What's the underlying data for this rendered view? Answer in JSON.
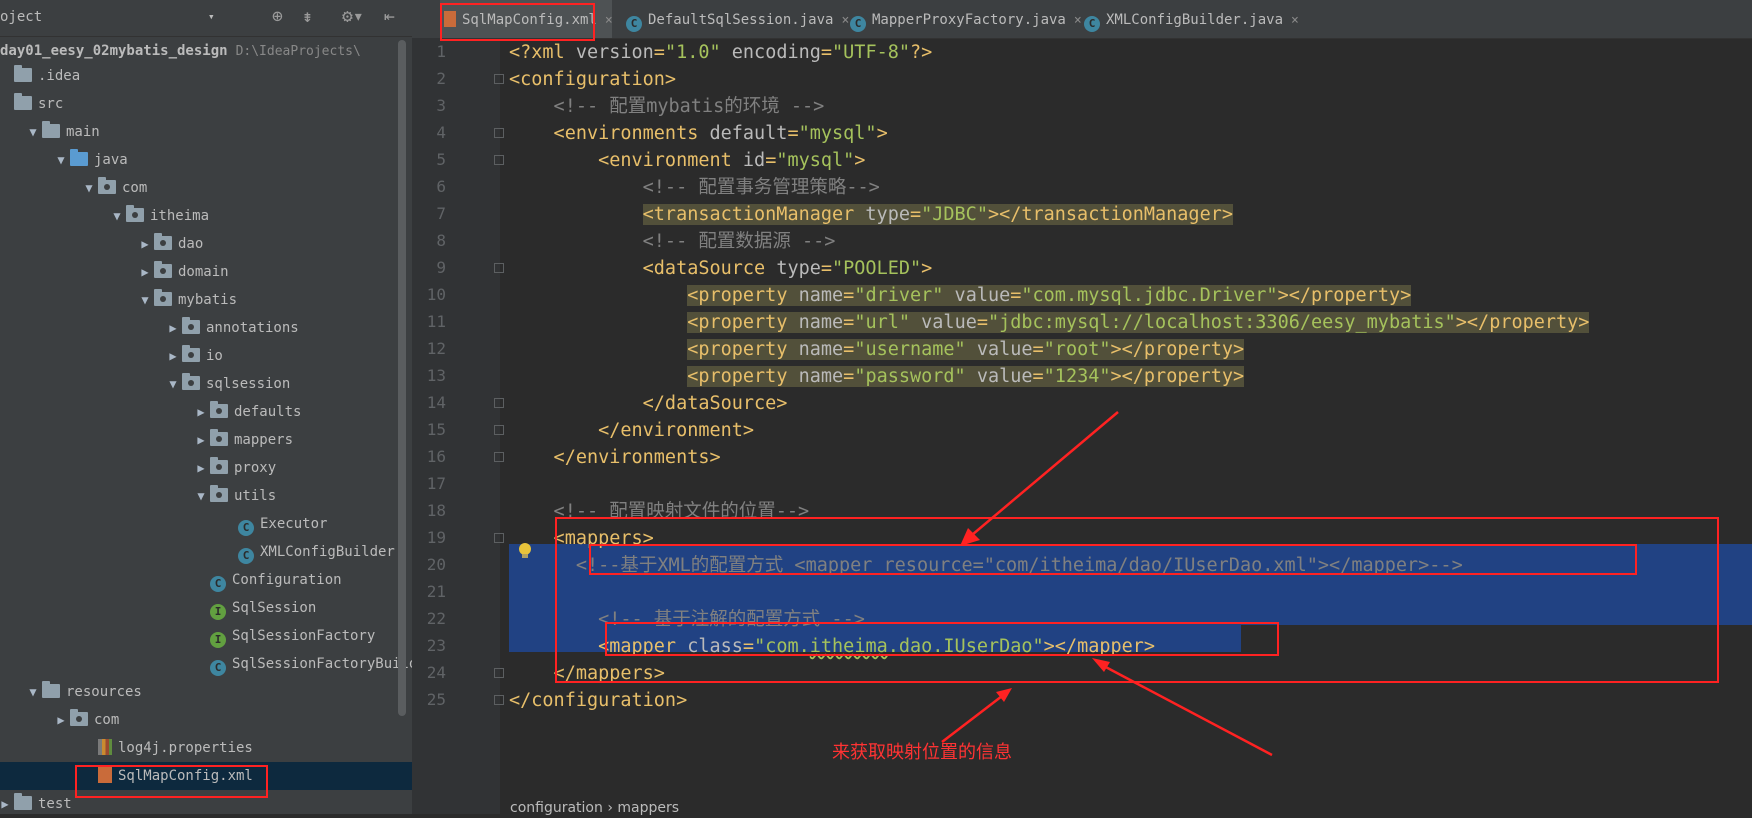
{
  "project_panel": {
    "header": {
      "title": "oject",
      "dropdown": "▾"
    },
    "toolbar": {
      "locate": "⊕",
      "collapse": "⇟",
      "settings": "⚙▾",
      "hide": "⇤"
    },
    "root": {
      "name": "day01_eesy_02mybatis_design",
      "path": "D:\\IdeaProjects\\"
    },
    "tree": [
      {
        "label": ".idea",
        "indent": 0,
        "arrow": "",
        "icon": "folder"
      },
      {
        "label": "src",
        "indent": 0,
        "arrow": "",
        "icon": "folder"
      },
      {
        "label": "main",
        "indent": 1,
        "arrow": "▼",
        "icon": "folder"
      },
      {
        "label": "java",
        "indent": 2,
        "arrow": "▼",
        "icon": "folder-src"
      },
      {
        "label": "com",
        "indent": 3,
        "arrow": "▼",
        "icon": "package"
      },
      {
        "label": "itheima",
        "indent": 4,
        "arrow": "▼",
        "icon": "package"
      },
      {
        "label": "dao",
        "indent": 5,
        "arrow": "▶",
        "icon": "package"
      },
      {
        "label": "domain",
        "indent": 5,
        "arrow": "▶",
        "icon": "package"
      },
      {
        "label": "mybatis",
        "indent": 5,
        "arrow": "▼",
        "icon": "package"
      },
      {
        "label": "annotations",
        "indent": 6,
        "arrow": "▶",
        "icon": "package"
      },
      {
        "label": "io",
        "indent": 6,
        "arrow": "▶",
        "icon": "package"
      },
      {
        "label": "sqlsession",
        "indent": 6,
        "arrow": "▼",
        "icon": "package"
      },
      {
        "label": "defaults",
        "indent": 7,
        "arrow": "▶",
        "icon": "package"
      },
      {
        "label": "mappers",
        "indent": 7,
        "arrow": "▶",
        "icon": "package"
      },
      {
        "label": "proxy",
        "indent": 7,
        "arrow": "▶",
        "icon": "package"
      },
      {
        "label": "utils",
        "indent": 7,
        "arrow": "▼",
        "icon": "package"
      },
      {
        "label": "Executor",
        "indent": 8,
        "arrow": "",
        "icon": "class-c"
      },
      {
        "label": "XMLConfigBuilder",
        "indent": 8,
        "arrow": "",
        "icon": "class-c"
      },
      {
        "label": "Configuration",
        "indent": 7,
        "arrow": "",
        "icon": "class-c"
      },
      {
        "label": "SqlSession",
        "indent": 7,
        "arrow": "",
        "icon": "class-i"
      },
      {
        "label": "SqlSessionFactory",
        "indent": 7,
        "arrow": "",
        "icon": "class-i"
      },
      {
        "label": "SqlSessionFactoryBuilde",
        "indent": 7,
        "arrow": "",
        "icon": "class-c"
      },
      {
        "label": "resources",
        "indent": 1,
        "arrow": "▼",
        "icon": "folder"
      },
      {
        "label": "com",
        "indent": 2,
        "arrow": "▶",
        "icon": "package"
      },
      {
        "label": "log4j.properties",
        "indent": 3,
        "arrow": "",
        "icon": "file-prop"
      },
      {
        "label": "SqlMapConfig.xml",
        "indent": 3,
        "arrow": "",
        "icon": "file-xml",
        "selected": true
      },
      {
        "label": "test",
        "indent": 0,
        "arrow": "▶",
        "icon": "folder"
      }
    ]
  },
  "tabs": [
    {
      "label": "SqlMapConfig.xml",
      "icon": "xml",
      "active": true
    },
    {
      "label": "DefaultSqlSession.java",
      "icon": "c",
      "active": false
    },
    {
      "label": "MapperProxyFactory.java",
      "icon": "c",
      "active": false
    },
    {
      "label": "XMLConfigBuilder.java",
      "icon": "c",
      "active": false
    }
  ],
  "tab_close": "×",
  "tab_icon_letter": "C",
  "line_numbers": [
    "1",
    "2",
    "3",
    "4",
    "5",
    "6",
    "7",
    "8",
    "9",
    "10",
    "11",
    "12",
    "13",
    "14",
    "15",
    "16",
    "17",
    "18",
    "19",
    "20",
    "21",
    "22",
    "23",
    "24",
    "25"
  ],
  "code_lines": [
    [
      [
        "t",
        "<?xml "
      ],
      [
        "a",
        "version"
      ],
      [
        "t",
        "="
      ],
      [
        "v",
        "\"1.0\""
      ],
      [
        "a",
        " encoding"
      ],
      [
        "t",
        "="
      ],
      [
        "v",
        "\"UTF-8\""
      ],
      [
        "t",
        "?>"
      ]
    ],
    [
      [
        "t",
        "<configuration>"
      ]
    ],
    [
      [
        "cm",
        "    <!-- 配置mybatis的环境 -->"
      ]
    ],
    [
      [
        "t",
        "    <environments "
      ],
      [
        "a",
        "default"
      ],
      [
        "t",
        "="
      ],
      [
        "v",
        "\"mysql\""
      ],
      [
        "t",
        ">"
      ]
    ],
    [
      [
        "t",
        "        <environment "
      ],
      [
        "a",
        "id"
      ],
      [
        "t",
        "="
      ],
      [
        "v",
        "\"mysql\""
      ],
      [
        "t",
        ">"
      ]
    ],
    [
      [
        "cm",
        "            <!-- 配置事务管理策略-->"
      ]
    ],
    [
      [
        "t",
        "            "
      ],
      [
        "t hl",
        "<transactionManager "
      ],
      [
        "a hl",
        "type"
      ],
      [
        "t hl",
        "="
      ],
      [
        "v hl",
        "\"JDBC\""
      ],
      [
        "t hl",
        "></transactionManager>"
      ]
    ],
    [
      [
        "cm",
        "            <!-- 配置数据源 -->"
      ]
    ],
    [
      [
        "t",
        "            <dataSource "
      ],
      [
        "a",
        "type"
      ],
      [
        "t",
        "="
      ],
      [
        "v",
        "\"POOLED\""
      ],
      [
        "t",
        ">"
      ]
    ],
    [
      [
        "t",
        "                "
      ],
      [
        "t hl",
        "<property "
      ],
      [
        "a hl",
        "name"
      ],
      [
        "t hl",
        "="
      ],
      [
        "v hl",
        "\"driver\""
      ],
      [
        "a hl",
        " value"
      ],
      [
        "t hl",
        "="
      ],
      [
        "v hl",
        "\"com.mysql.jdbc.Driver\""
      ],
      [
        "t hl",
        "></property>"
      ]
    ],
    [
      [
        "t",
        "                "
      ],
      [
        "t hl",
        "<property "
      ],
      [
        "a hl",
        "name"
      ],
      [
        "t hl",
        "="
      ],
      [
        "v hl",
        "\"url\""
      ],
      [
        "a hl",
        " value"
      ],
      [
        "t hl",
        "="
      ],
      [
        "v hl",
        "\"jdbc:mysql://localhost:3306/eesy_mybatis\""
      ],
      [
        "t hl",
        "></property>"
      ]
    ],
    [
      [
        "t",
        "                "
      ],
      [
        "t hl",
        "<property "
      ],
      [
        "a hl",
        "name"
      ],
      [
        "t hl",
        "="
      ],
      [
        "v hl",
        "\"username\""
      ],
      [
        "a hl",
        " value"
      ],
      [
        "t hl",
        "="
      ],
      [
        "v hl",
        "\"root\""
      ],
      [
        "t hl",
        "></property>"
      ]
    ],
    [
      [
        "t",
        "                "
      ],
      [
        "t hl",
        "<property "
      ],
      [
        "a hl",
        "name"
      ],
      [
        "t hl",
        "="
      ],
      [
        "v hl",
        "\"password\""
      ],
      [
        "a hl",
        " value"
      ],
      [
        "t hl",
        "="
      ],
      [
        "v hl",
        "\"1234\""
      ],
      [
        "t hl",
        "></property>"
      ]
    ],
    [
      [
        "t",
        "            </dataSource>"
      ]
    ],
    [
      [
        "t",
        "        </environment>"
      ]
    ],
    [
      [
        "t",
        "    </environments>"
      ]
    ],
    [],
    [
      [
        "cm",
        "    <!-- 配置映射文件的位置-->"
      ]
    ],
    [
      [
        "t",
        "    <mappers>"
      ]
    ],
    [
      [
        "cm",
        "      <!--基于XML的配置方式 <mapper resource=\"com/itheima/dao/IUserDao.xml\"></mapper>-->"
      ]
    ],
    [],
    [
      [
        "cm",
        "        <!-- 基于注解的配置方式 -->"
      ]
    ],
    [
      [
        "t",
        "        <mapper "
      ],
      [
        "a",
        "class"
      ],
      [
        "t",
        "="
      ],
      [
        "v",
        "\"com."
      ],
      [
        "v u",
        "itheima"
      ],
      [
        "v",
        ".dao.IUserDao\""
      ],
      [
        "t",
        "></mapper>"
      ]
    ],
    [
      [
        "t",
        "    </mappers>"
      ]
    ],
    [
      [
        "t",
        "</configuration>"
      ]
    ]
  ],
  "breadcrumb": "configuration  ›  mappers",
  "annotation": "来获取映射位置的信息",
  "colors": {
    "annotation_red": "#ff2222",
    "selection_blue": "#214283",
    "highlight_bg": "#52503a"
  }
}
